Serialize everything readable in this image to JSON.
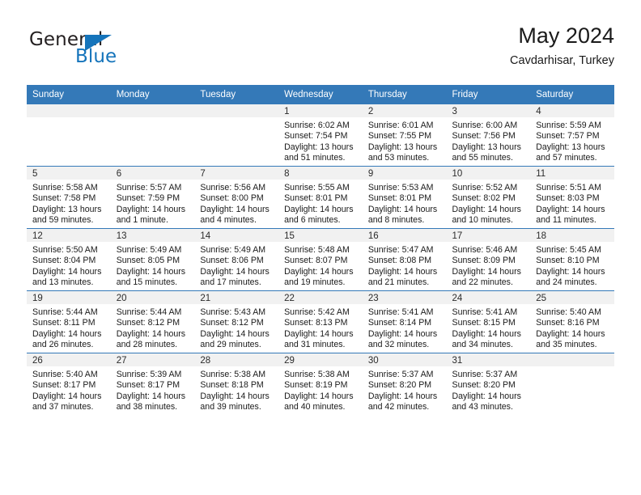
{
  "brand": {
    "logo_primary": "General",
    "logo_secondary": "Blue",
    "logo_triangle_color": "#1574bb",
    "logo_text_color": "#231f20"
  },
  "header": {
    "title": "May 2024",
    "subtitle": "Cavdarhisar, Turkey"
  },
  "theme": {
    "header_bg": "#3479b8",
    "header_text": "#ffffff",
    "daynum_strip_bg": "#f1f1f1",
    "row_divider": "#3479b8",
    "body_text": "#1a1a1a"
  },
  "weekday_headers": [
    "Sunday",
    "Monday",
    "Tuesday",
    "Wednesday",
    "Thursday",
    "Friday",
    "Saturday"
  ],
  "labels": {
    "sunrise_prefix": "Sunrise:",
    "sunset_prefix": "Sunset:",
    "daylight_prefix": "Daylight:"
  },
  "weeks": [
    [
      {
        "day": "",
        "empty": true,
        "sunrise": "",
        "sunset": "",
        "daylight_1": "",
        "daylight_2": ""
      },
      {
        "day": "",
        "empty": true,
        "sunrise": "",
        "sunset": "",
        "daylight_1": "",
        "daylight_2": ""
      },
      {
        "day": "",
        "empty": true,
        "sunrise": "",
        "sunset": "",
        "daylight_1": "",
        "daylight_2": ""
      },
      {
        "day": "1",
        "empty": false,
        "sunrise": "Sunrise: 6:02 AM",
        "sunset": "Sunset: 7:54 PM",
        "daylight_1": "Daylight: 13 hours",
        "daylight_2": "and 51 minutes."
      },
      {
        "day": "2",
        "empty": false,
        "sunrise": "Sunrise: 6:01 AM",
        "sunset": "Sunset: 7:55 PM",
        "daylight_1": "Daylight: 13 hours",
        "daylight_2": "and 53 minutes."
      },
      {
        "day": "3",
        "empty": false,
        "sunrise": "Sunrise: 6:00 AM",
        "sunset": "Sunset: 7:56 PM",
        "daylight_1": "Daylight: 13 hours",
        "daylight_2": "and 55 minutes."
      },
      {
        "day": "4",
        "empty": false,
        "sunrise": "Sunrise: 5:59 AM",
        "sunset": "Sunset: 7:57 PM",
        "daylight_1": "Daylight: 13 hours",
        "daylight_2": "and 57 minutes."
      }
    ],
    [
      {
        "day": "5",
        "empty": false,
        "sunrise": "Sunrise: 5:58 AM",
        "sunset": "Sunset: 7:58 PM",
        "daylight_1": "Daylight: 13 hours",
        "daylight_2": "and 59 minutes."
      },
      {
        "day": "6",
        "empty": false,
        "sunrise": "Sunrise: 5:57 AM",
        "sunset": "Sunset: 7:59 PM",
        "daylight_1": "Daylight: 14 hours",
        "daylight_2": "and 1 minute."
      },
      {
        "day": "7",
        "empty": false,
        "sunrise": "Sunrise: 5:56 AM",
        "sunset": "Sunset: 8:00 PM",
        "daylight_1": "Daylight: 14 hours",
        "daylight_2": "and 4 minutes."
      },
      {
        "day": "8",
        "empty": false,
        "sunrise": "Sunrise: 5:55 AM",
        "sunset": "Sunset: 8:01 PM",
        "daylight_1": "Daylight: 14 hours",
        "daylight_2": "and 6 minutes."
      },
      {
        "day": "9",
        "empty": false,
        "sunrise": "Sunrise: 5:53 AM",
        "sunset": "Sunset: 8:01 PM",
        "daylight_1": "Daylight: 14 hours",
        "daylight_2": "and 8 minutes."
      },
      {
        "day": "10",
        "empty": false,
        "sunrise": "Sunrise: 5:52 AM",
        "sunset": "Sunset: 8:02 PM",
        "daylight_1": "Daylight: 14 hours",
        "daylight_2": "and 10 minutes."
      },
      {
        "day": "11",
        "empty": false,
        "sunrise": "Sunrise: 5:51 AM",
        "sunset": "Sunset: 8:03 PM",
        "daylight_1": "Daylight: 14 hours",
        "daylight_2": "and 11 minutes."
      }
    ],
    [
      {
        "day": "12",
        "empty": false,
        "sunrise": "Sunrise: 5:50 AM",
        "sunset": "Sunset: 8:04 PM",
        "daylight_1": "Daylight: 14 hours",
        "daylight_2": "and 13 minutes."
      },
      {
        "day": "13",
        "empty": false,
        "sunrise": "Sunrise: 5:49 AM",
        "sunset": "Sunset: 8:05 PM",
        "daylight_1": "Daylight: 14 hours",
        "daylight_2": "and 15 minutes."
      },
      {
        "day": "14",
        "empty": false,
        "sunrise": "Sunrise: 5:49 AM",
        "sunset": "Sunset: 8:06 PM",
        "daylight_1": "Daylight: 14 hours",
        "daylight_2": "and 17 minutes."
      },
      {
        "day": "15",
        "empty": false,
        "sunrise": "Sunrise: 5:48 AM",
        "sunset": "Sunset: 8:07 PM",
        "daylight_1": "Daylight: 14 hours",
        "daylight_2": "and 19 minutes."
      },
      {
        "day": "16",
        "empty": false,
        "sunrise": "Sunrise: 5:47 AM",
        "sunset": "Sunset: 8:08 PM",
        "daylight_1": "Daylight: 14 hours",
        "daylight_2": "and 21 minutes."
      },
      {
        "day": "17",
        "empty": false,
        "sunrise": "Sunrise: 5:46 AM",
        "sunset": "Sunset: 8:09 PM",
        "daylight_1": "Daylight: 14 hours",
        "daylight_2": "and 22 minutes."
      },
      {
        "day": "18",
        "empty": false,
        "sunrise": "Sunrise: 5:45 AM",
        "sunset": "Sunset: 8:10 PM",
        "daylight_1": "Daylight: 14 hours",
        "daylight_2": "and 24 minutes."
      }
    ],
    [
      {
        "day": "19",
        "empty": false,
        "sunrise": "Sunrise: 5:44 AM",
        "sunset": "Sunset: 8:11 PM",
        "daylight_1": "Daylight: 14 hours",
        "daylight_2": "and 26 minutes."
      },
      {
        "day": "20",
        "empty": false,
        "sunrise": "Sunrise: 5:44 AM",
        "sunset": "Sunset: 8:12 PM",
        "daylight_1": "Daylight: 14 hours",
        "daylight_2": "and 28 minutes."
      },
      {
        "day": "21",
        "empty": false,
        "sunrise": "Sunrise: 5:43 AM",
        "sunset": "Sunset: 8:12 PM",
        "daylight_1": "Daylight: 14 hours",
        "daylight_2": "and 29 minutes."
      },
      {
        "day": "22",
        "empty": false,
        "sunrise": "Sunrise: 5:42 AM",
        "sunset": "Sunset: 8:13 PM",
        "daylight_1": "Daylight: 14 hours",
        "daylight_2": "and 31 minutes."
      },
      {
        "day": "23",
        "empty": false,
        "sunrise": "Sunrise: 5:41 AM",
        "sunset": "Sunset: 8:14 PM",
        "daylight_1": "Daylight: 14 hours",
        "daylight_2": "and 32 minutes."
      },
      {
        "day": "24",
        "empty": false,
        "sunrise": "Sunrise: 5:41 AM",
        "sunset": "Sunset: 8:15 PM",
        "daylight_1": "Daylight: 14 hours",
        "daylight_2": "and 34 minutes."
      },
      {
        "day": "25",
        "empty": false,
        "sunrise": "Sunrise: 5:40 AM",
        "sunset": "Sunset: 8:16 PM",
        "daylight_1": "Daylight: 14 hours",
        "daylight_2": "and 35 minutes."
      }
    ],
    [
      {
        "day": "26",
        "empty": false,
        "sunrise": "Sunrise: 5:40 AM",
        "sunset": "Sunset: 8:17 PM",
        "daylight_1": "Daylight: 14 hours",
        "daylight_2": "and 37 minutes."
      },
      {
        "day": "27",
        "empty": false,
        "sunrise": "Sunrise: 5:39 AM",
        "sunset": "Sunset: 8:17 PM",
        "daylight_1": "Daylight: 14 hours",
        "daylight_2": "and 38 minutes."
      },
      {
        "day": "28",
        "empty": false,
        "sunrise": "Sunrise: 5:38 AM",
        "sunset": "Sunset: 8:18 PM",
        "daylight_1": "Daylight: 14 hours",
        "daylight_2": "and 39 minutes."
      },
      {
        "day": "29",
        "empty": false,
        "sunrise": "Sunrise: 5:38 AM",
        "sunset": "Sunset: 8:19 PM",
        "daylight_1": "Daylight: 14 hours",
        "daylight_2": "and 40 minutes."
      },
      {
        "day": "30",
        "empty": false,
        "sunrise": "Sunrise: 5:37 AM",
        "sunset": "Sunset: 8:20 PM",
        "daylight_1": "Daylight: 14 hours",
        "daylight_2": "and 42 minutes."
      },
      {
        "day": "31",
        "empty": false,
        "sunrise": "Sunrise: 5:37 AM",
        "sunset": "Sunset: 8:20 PM",
        "daylight_1": "Daylight: 14 hours",
        "daylight_2": "and 43 minutes."
      },
      {
        "day": "",
        "empty": true,
        "sunrise": "",
        "sunset": "",
        "daylight_1": "",
        "daylight_2": ""
      }
    ]
  ]
}
